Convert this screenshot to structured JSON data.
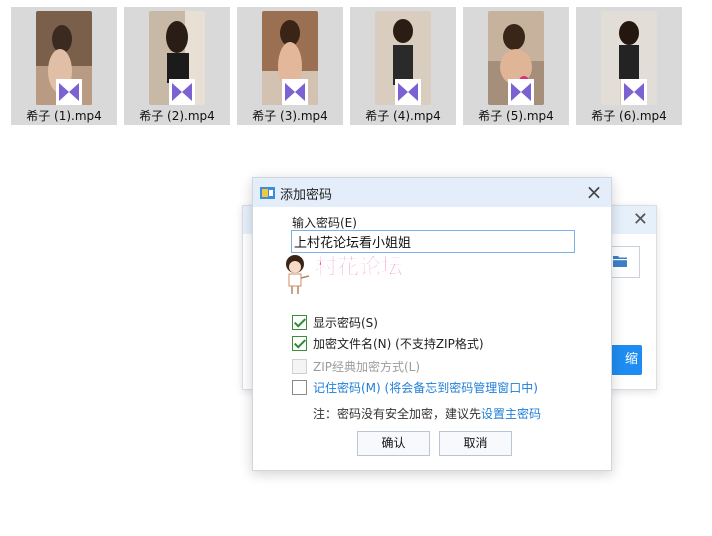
{
  "files": [
    {
      "name": "希子 (1).mp4",
      "icon": "video-file-icon"
    },
    {
      "name": "希子 (2).mp4",
      "icon": "video-file-icon"
    },
    {
      "name": "希子 (3).mp4",
      "icon": "video-file-icon"
    },
    {
      "name": "希子 (4).mp4",
      "icon": "video-file-icon"
    },
    {
      "name": "希子 (5).mp4",
      "icon": "video-file-icon"
    },
    {
      "name": "希子 (6).mp4",
      "icon": "video-file-icon"
    }
  ],
  "background_dialog": {
    "button_label": "缩"
  },
  "dialog": {
    "title": "添加密码",
    "password_label": "输入密码(E)",
    "password_value": "上村花论坛看小姐姐",
    "watermark_text": "村花论坛",
    "options": [
      {
        "label": "显示密码(S)",
        "checked": true,
        "enabled": true
      },
      {
        "label": "加密文件名(N) (不支持ZIP格式)",
        "checked": true,
        "enabled": true
      },
      {
        "label": "ZIP经典加密方式(L)",
        "checked": false,
        "enabled": false
      },
      {
        "label": "记住密码(M) (将会备忘到密码管理窗口中)",
        "checked": false,
        "enabled": true
      }
    ],
    "note_prefix": "注：密码没有安全加密，建议先",
    "note_link": "设置主密码",
    "ok_label": "确认",
    "cancel_label": "取消"
  },
  "colors": {
    "accent": "#1e8cf0",
    "link": "#1e7fd8",
    "watermark": "#e8379b",
    "check": "#2f8a2f"
  }
}
